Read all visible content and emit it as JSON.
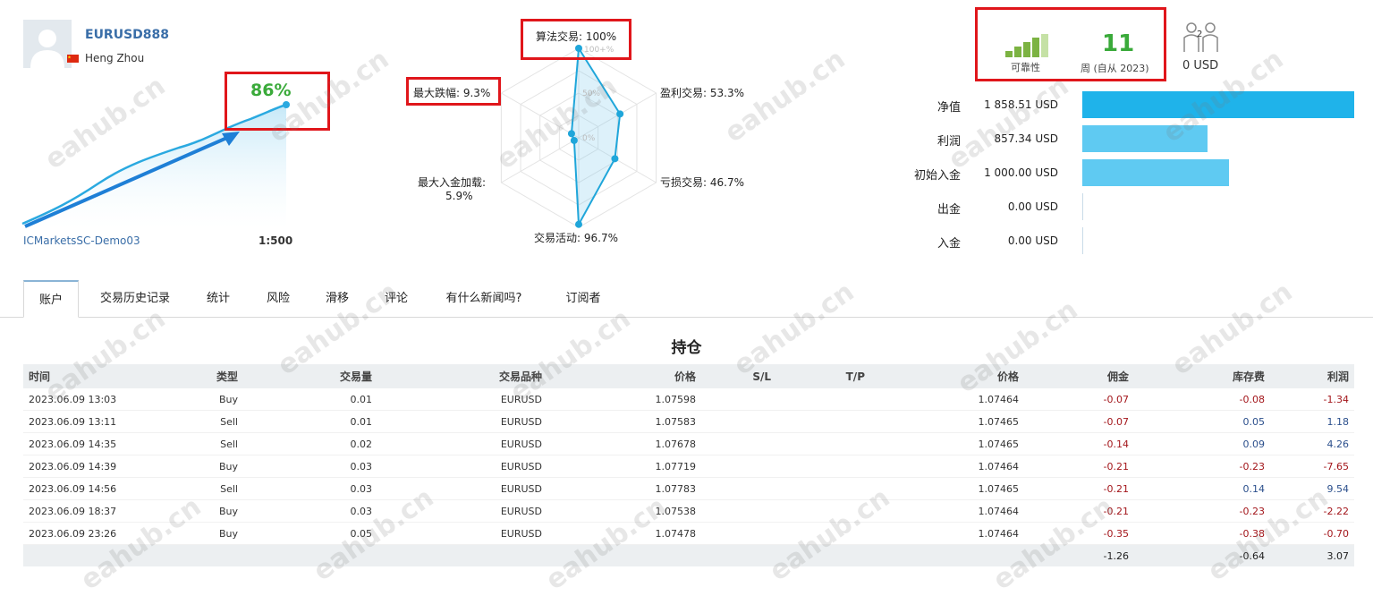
{
  "profile": {
    "account_name": "EURUSD888",
    "owner_name": "Heng Zhou",
    "growth": "86%",
    "server": "ICMarketsSC-Demo03",
    "leverage": "1:500"
  },
  "radar": {
    "algo": "算法交易: 100%",
    "profit_trades": "盈利交易: 53.3%",
    "loss_trades": "亏损交易: 46.7%",
    "activity": "交易活动: 96.7%",
    "max_load_line1": "最大入金加载:",
    "max_load_line2": "5.9%",
    "max_drawdown": "最大跌幅: 9.3%",
    "scale_100": "100+%",
    "scale_50": "50%",
    "scale_0": "0%",
    "values": {
      "algo": 100,
      "profit": 53.3,
      "loss": 46.7,
      "activity": 96.7,
      "load": 5.9,
      "drawdown": 9.3
    }
  },
  "reliability": {
    "label": "可靠性",
    "weeks": "11",
    "weeks_label": "周 (自从 2023)",
    "subscribers": "2",
    "subscriber_funds": "0 USD",
    "bar_colors": [
      "#7cb342",
      "#7cb342",
      "#7cb342",
      "#7cb342",
      "#c5e1a5"
    ]
  },
  "financials": [
    {
      "label": "净值",
      "value": "1 858.51 USD",
      "amount": 1858.51,
      "color": "#1fb3ea"
    },
    {
      "label": "利润",
      "value": "857.34 USD",
      "amount": 857.34,
      "color": "#5fcaf2"
    },
    {
      "label": "初始入金",
      "value": "1 000.00 USD",
      "amount": 1000.0,
      "color": "#5fcaf2"
    },
    {
      "label": "出金",
      "value": "0.00 USD",
      "amount": 0,
      "color": "#5fcaf2"
    },
    {
      "label": "入金",
      "value": "0.00 USD",
      "amount": 0,
      "color": "#5fcaf2"
    }
  ],
  "tabs": [
    "账户",
    "交易历史记录",
    "统计",
    "风险",
    "滑移",
    "评论",
    "有什么新闻吗?",
    "订阅者"
  ],
  "positions": {
    "title": "持仓",
    "headers": [
      "时间",
      "类型",
      "交易量",
      "交易品种",
      "价格",
      "S/L",
      "T/P",
      "价格",
      "佣金",
      "库存费",
      "利润"
    ],
    "rows": [
      [
        "2023.06.09 13:03",
        "Buy",
        "0.01",
        "EURUSD",
        "1.07598",
        "",
        "",
        "1.07464",
        "-0.07",
        "-0.08",
        "-1.34"
      ],
      [
        "2023.06.09 13:11",
        "Sell",
        "0.01",
        "EURUSD",
        "1.07583",
        "",
        "",
        "1.07465",
        "-0.07",
        "0.05",
        "1.18"
      ],
      [
        "2023.06.09 14:35",
        "Sell",
        "0.02",
        "EURUSD",
        "1.07678",
        "",
        "",
        "1.07465",
        "-0.14",
        "0.09",
        "4.26"
      ],
      [
        "2023.06.09 14:39",
        "Buy",
        "0.03",
        "EURUSD",
        "1.07719",
        "",
        "",
        "1.07464",
        "-0.21",
        "-0.23",
        "-7.65"
      ],
      [
        "2023.06.09 14:56",
        "Sell",
        "0.03",
        "EURUSD",
        "1.07783",
        "",
        "",
        "1.07465",
        "-0.21",
        "0.14",
        "9.54"
      ],
      [
        "2023.06.09 18:37",
        "Buy",
        "0.03",
        "EURUSD",
        "1.07538",
        "",
        "",
        "1.07464",
        "-0.21",
        "-0.23",
        "-2.22"
      ],
      [
        "2023.06.09 23:26",
        "Buy",
        "0.05",
        "EURUSD",
        "1.07478",
        "",
        "",
        "1.07464",
        "-0.35",
        "-0.38",
        "-0.70"
      ]
    ],
    "totals": {
      "commission": "-1.26",
      "swap": "-0.64",
      "profit": "3.07"
    }
  },
  "watermark": "eahub.cn"
}
